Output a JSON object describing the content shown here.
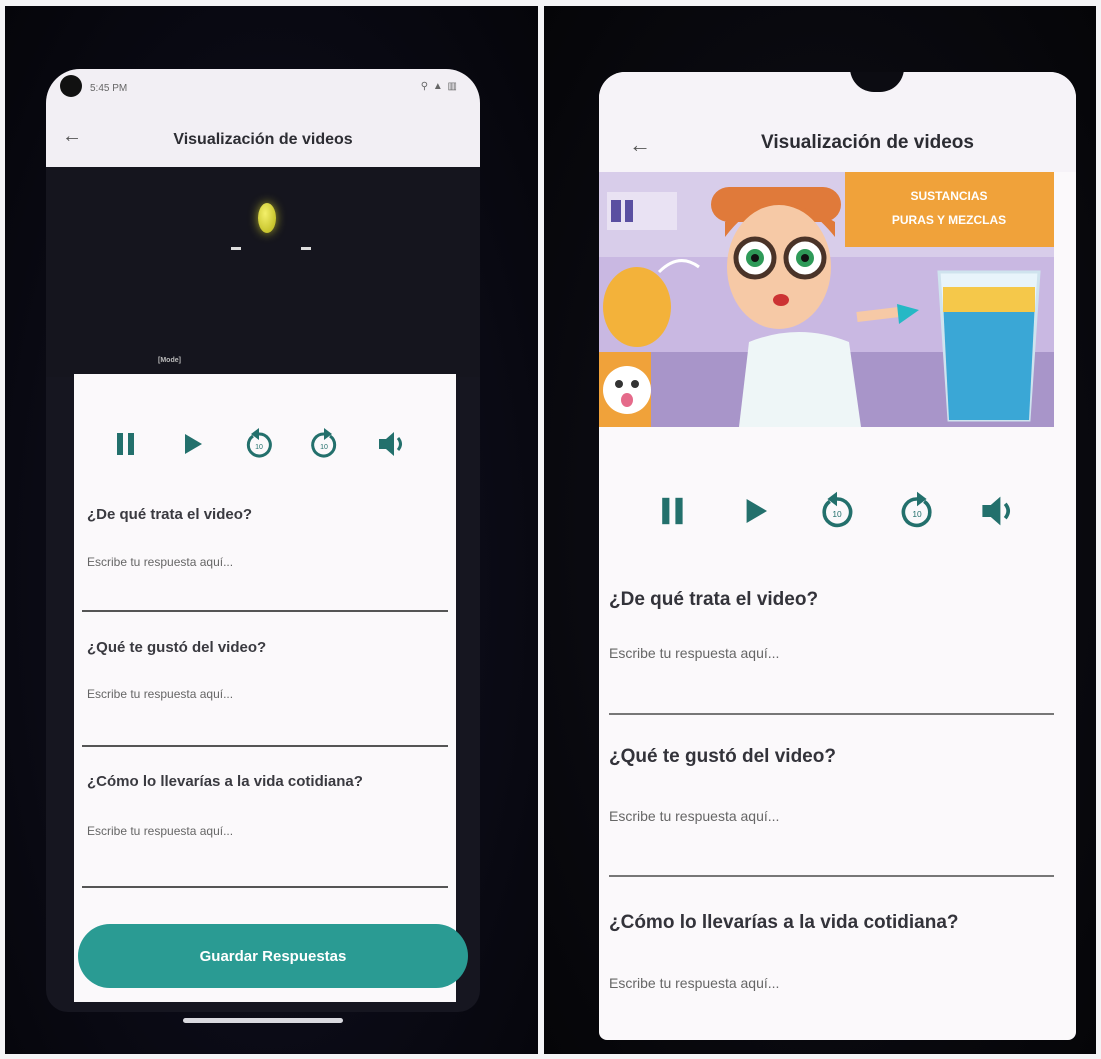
{
  "left_phone": {
    "status_time": "5:45 PM",
    "status_icons": "⚲ ▲ ▥",
    "app_title": "Visualización de videos",
    "video_tag": "[Mode]",
    "questions": [
      {
        "label": "¿De qué trata el video?",
        "placeholder": "Escribe tu respuesta aquí..."
      },
      {
        "label": "¿Qué te gustó del video?",
        "placeholder": "Escribe tu respuesta aquí..."
      },
      {
        "label": "¿Cómo lo llevarías a la vida cotidiana?",
        "placeholder": "Escribe tu respuesta aquí..."
      }
    ],
    "save_button": "Guardar Respuestas"
  },
  "right_phone": {
    "app_title": "Visualización de videos",
    "thumbnail_text": [
      "SUSTANCIAS",
      "PURAS Y MEZCLAS"
    ],
    "questions": [
      {
        "label": "¿De qué trata el video?",
        "placeholder": "Escribe tu respuesta aquí..."
      },
      {
        "label": "¿Qué te gustó del video?",
        "placeholder": "Escribe tu respuesta aquí..."
      },
      {
        "label": "¿Cómo lo llevarías a la vida cotidiana?",
        "placeholder": "Escribe tu respuesta aquí..."
      }
    ]
  },
  "controls": [
    "pause-icon",
    "play-icon",
    "rewind-10-icon",
    "forward-10-icon",
    "volume-icon"
  ],
  "colors": {
    "accent": "#2a9b93",
    "icon": "#23706c",
    "thumb_orange": "#f0a23a",
    "thumb_purple": "#b9a6d6"
  }
}
